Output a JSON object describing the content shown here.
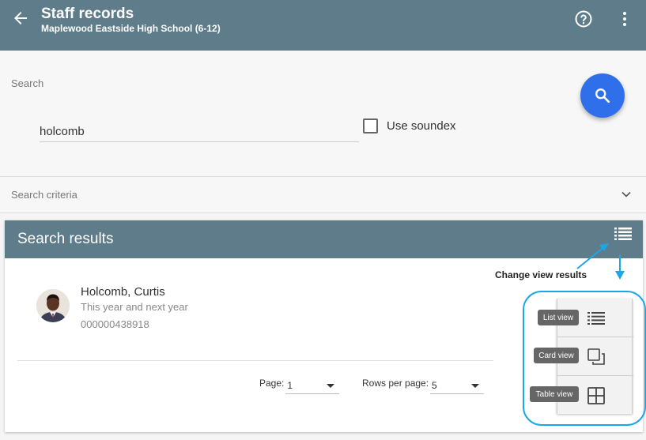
{
  "app_bar": {
    "title": "Staff records",
    "subtitle": "Maplewood Eastside High School (6-12)"
  },
  "search": {
    "label": "Search",
    "value": "holcomb",
    "soundex_label": "Use soundex",
    "soundex_checked": false
  },
  "criteria": {
    "label": "Search criteria"
  },
  "results": {
    "title": "Search results",
    "items": [
      {
        "name": "Holcomb, Curtis",
        "subtitle": "This year and next year",
        "id": "000000438918"
      }
    ],
    "pager": {
      "page_label": "Page:",
      "page_value": "1",
      "rows_label": "Rows per page:",
      "rows_value": "5"
    }
  },
  "callout": {
    "text": "Change view results"
  },
  "view_options": [
    {
      "label": "List view",
      "icon": "list-icon"
    },
    {
      "label": "Card view",
      "icon": "card-icon"
    },
    {
      "label": "Table view",
      "icon": "table-icon"
    }
  ],
  "colors": {
    "app_bar": "#5f7c8a",
    "fab": "#2f6fe9",
    "annotation": "#1aa7ea"
  }
}
